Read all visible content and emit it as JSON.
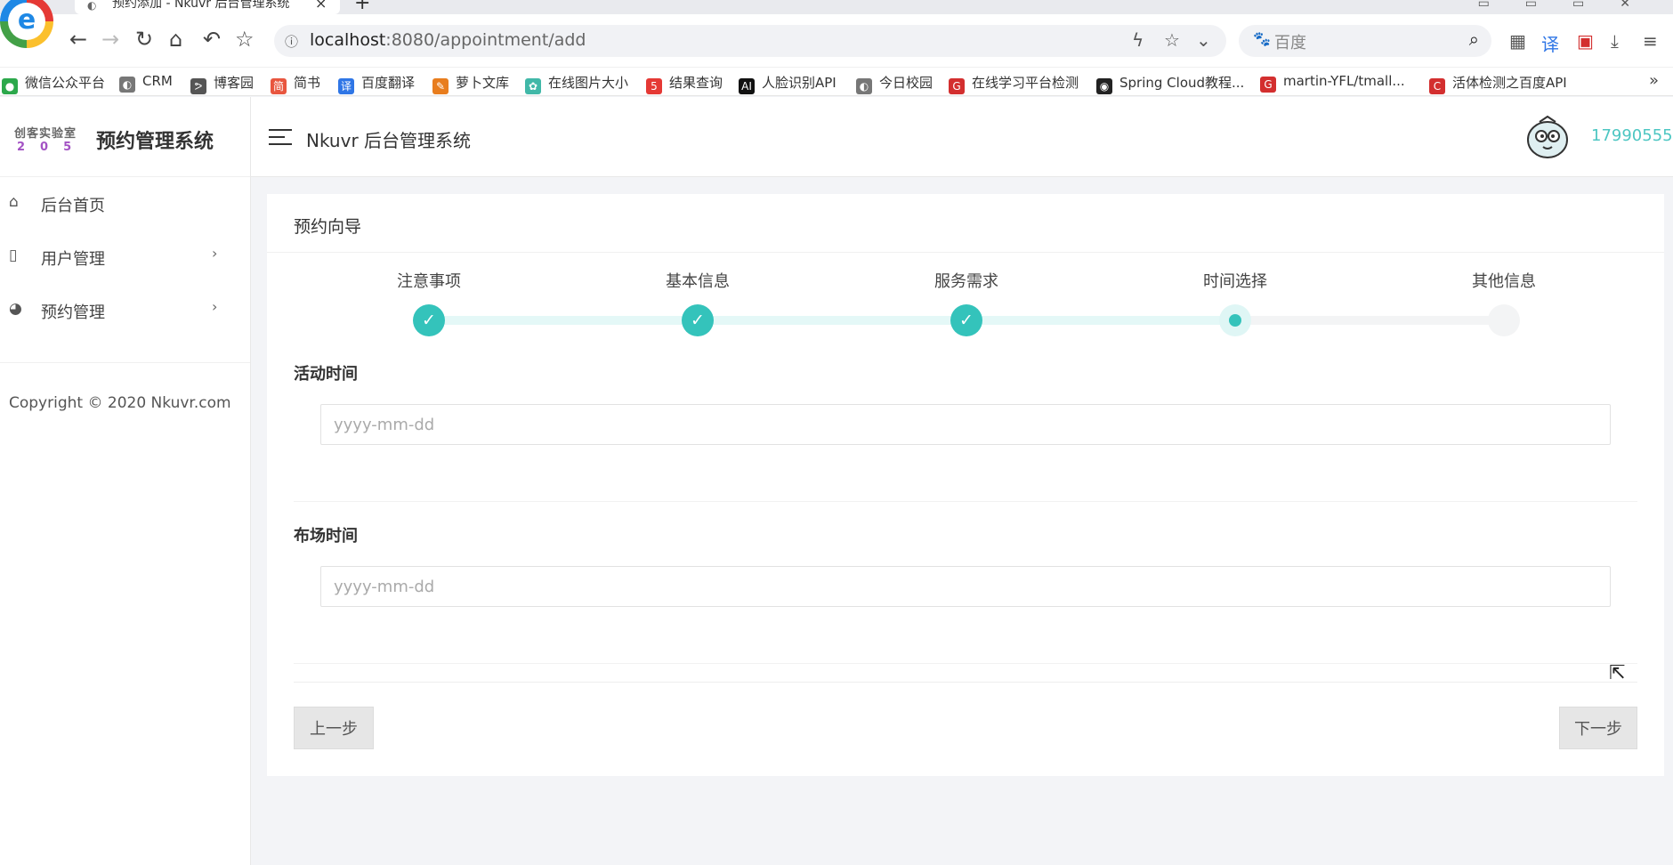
{
  "browser": {
    "tab_title": "预约添加 - Nkuvr 后台管理系统",
    "url_host": "localhost",
    "url_rest": ":8080/appointment/add",
    "search_placeholder": "百度"
  },
  "bookmarks": [
    {
      "label": "微信公众平台",
      "color": "#2ca84b",
      "icon": "wechat-icon"
    },
    {
      "label": "CRM",
      "color": "#777777",
      "icon": "globe-icon"
    },
    {
      "label": "博客园",
      "color": "#555555",
      "icon": "blog-icon"
    },
    {
      "label": "简书",
      "color": "#e8563f",
      "icon": "jianshu-icon"
    },
    {
      "label": "百度翻译",
      "color": "#2f76e6",
      "icon": "translate-icon"
    },
    {
      "label": "萝卜文库",
      "color": "#e87d1e",
      "icon": "carrot-icon"
    },
    {
      "label": "在线图片大小",
      "color": "#41b8a8",
      "icon": "gear-icon"
    },
    {
      "label": "结果查询",
      "color": "#e53935",
      "icon": "five-icon"
    },
    {
      "label": "人脸识别API",
      "color": "#111111",
      "icon": "ai-icon"
    },
    {
      "label": "今日校园",
      "color": "#777777",
      "icon": "globe-icon"
    },
    {
      "label": "在线学习平台检测",
      "color": "#d32f2f",
      "icon": "g-icon"
    },
    {
      "label": "Spring Cloud教程...",
      "color": "#222222",
      "icon": "github-icon"
    },
    {
      "label": "martin-YFL/tmall...",
      "color": "#d32f2f",
      "icon": "g-icon"
    },
    {
      "label": "活体检测之百度API",
      "color": "#d32f2f",
      "icon": "c-icon"
    }
  ],
  "sidebar": {
    "logo_line1": "创客实验室",
    "logo_line2": "205",
    "brand_name": "预约管理系统",
    "items": [
      {
        "label": "后台首页",
        "icon": "home-icon"
      },
      {
        "label": "用户管理",
        "icon": "file-icon"
      },
      {
        "label": "预约管理",
        "icon": "palette-icon"
      }
    ],
    "copyright": "Copyright © 2020 Nkuvr.com"
  },
  "header": {
    "title": "Nkuvr 后台管理系统",
    "username": "17990555"
  },
  "wizard": {
    "title": "预约向导",
    "steps": [
      {
        "label": "注意事项",
        "status": "done"
      },
      {
        "label": "基本信息",
        "status": "done"
      },
      {
        "label": "服务需求",
        "status": "done"
      },
      {
        "label": "时间选择",
        "status": "current"
      },
      {
        "label": "其他信息",
        "status": "todo"
      }
    ],
    "fields": [
      {
        "label": "活动时间",
        "placeholder": "yyyy-mm-dd",
        "value": ""
      },
      {
        "label": "布场时间",
        "placeholder": "yyyy-mm-dd",
        "value": ""
      }
    ],
    "prev_label": "上一步",
    "next_label": "下一步"
  },
  "colors": {
    "accent": "#34c3bb",
    "username": "#4cc6c2"
  }
}
